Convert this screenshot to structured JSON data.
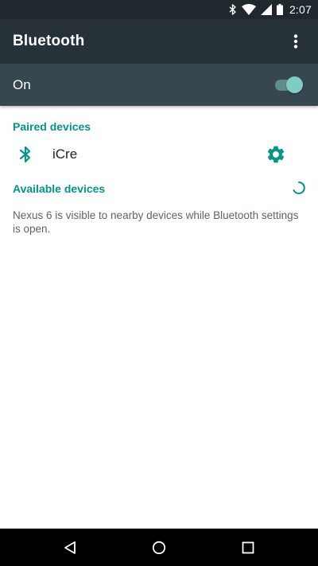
{
  "status_bar": {
    "time": "2:07",
    "icons": [
      "bluetooth-icon",
      "wifi-icon",
      "signal-icon",
      "battery-icon"
    ]
  },
  "toolbar": {
    "title": "Bluetooth",
    "overflow_icon": "more-vert-icon"
  },
  "master_switch": {
    "label": "On",
    "state": "on"
  },
  "paired": {
    "header": "Paired devices",
    "devices": [
      {
        "name": "iCre",
        "icon": "bluetooth-icon",
        "settings_icon": "gear-icon"
      }
    ]
  },
  "available": {
    "header": "Available devices",
    "info": "Nexus 6 is visible to nearby devices while Bluetooth settings is open."
  },
  "nav_bar": {
    "buttons": [
      "back-icon",
      "home-icon",
      "recents-icon"
    ]
  },
  "colors": {
    "status_bar": "#1f282c",
    "toolbar": "#263238",
    "switch_bar": "#37474f",
    "accent": "#009688",
    "toggle_thumb": "#80cbc4"
  }
}
